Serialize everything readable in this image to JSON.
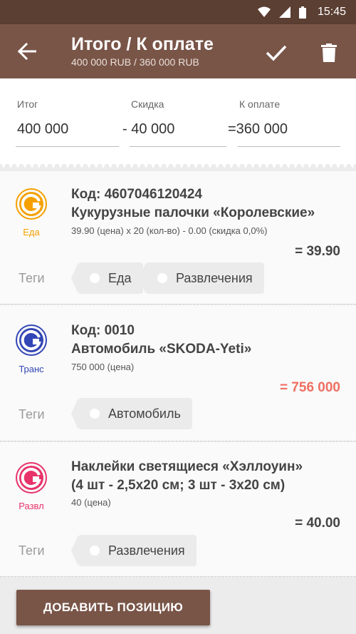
{
  "statusbar": {
    "time": "15:45"
  },
  "toolbar": {
    "title": "Итого / К оплате",
    "subtitle": "400 000 RUB / 360 000 RUB"
  },
  "summary": {
    "total_label": "Итог",
    "total_value": "400 000",
    "discount_label": "Скидка",
    "discount_value": "- 40 000",
    "pay_label": "К оплате",
    "pay_value": "=360 000"
  },
  "items": [
    {
      "category": "Еда",
      "category_color": "#f5a000",
      "code": "Код: 4607046120424",
      "name": "Кукурузные палочки «Королевские»",
      "detail": "39.90 (цена) x 20 (кол-во) - 0.00 (скидка 0,0%)",
      "total": "= 39.90",
      "tags_label": "Теги",
      "tags": [
        "Еда",
        "Развлечения"
      ]
    },
    {
      "category": "Транс",
      "category_color": "#3346b5",
      "code": "Код: 0010",
      "name": "Автомобиль «SKODA-Yeti»",
      "detail": "750 000 (цена)",
      "total": "= 756 000",
      "tags_label": "Теги",
      "tags": [
        "Автомобиль"
      ]
    },
    {
      "category": "Развл",
      "category_color": "#e8336a",
      "name_line1": "Наклейки светящиеся «Хэллоуин»",
      "name_line2": "(4 шт - 2,5x20 см; 3 шт - 3x20 см)",
      "detail": "40 (цена)",
      "total": "= 40.00",
      "tags_label": "Теги",
      "tags": [
        "Развлечения"
      ]
    }
  ],
  "add_button": "ДОБАВИТЬ ПОЗИЦИЮ"
}
